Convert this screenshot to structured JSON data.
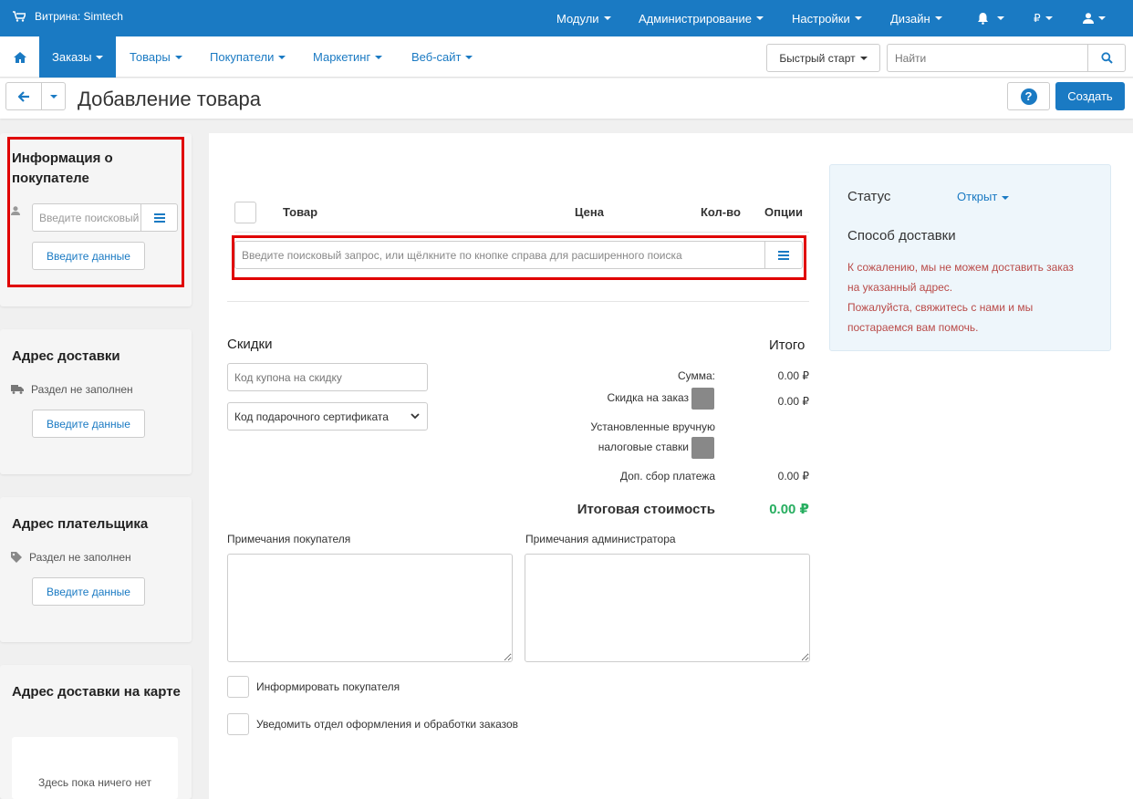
{
  "topbar": {
    "store_label": "Витрина: Simtech",
    "menu": [
      "Модули",
      "Администрирование",
      "Настройки",
      "Дизайн"
    ],
    "currency": "₽"
  },
  "nav": {
    "items": [
      "Заказы",
      "Товары",
      "Покупатели",
      "Маркетинг",
      "Веб-сайт"
    ],
    "quickstart": "Быстрый старт",
    "search_placeholder": "Найти"
  },
  "titlebar": {
    "title": "Добавление товара",
    "help": "?",
    "create": "Создать"
  },
  "sidebar": {
    "customer": {
      "title": "Информация о покупателе",
      "search_placeholder": "Введите поисковый",
      "enter_data": "Введите данные"
    },
    "shipping": {
      "title": "Адрес доставки",
      "empty": "Раздел не заполнен",
      "enter_data": "Введите данные"
    },
    "billing": {
      "title": "Адрес плательщика",
      "empty": "Раздел не заполнен",
      "enter_data": "Введите данные"
    },
    "map": {
      "title": "Адрес доставки на карте",
      "empty": "Здесь пока ничего нет"
    }
  },
  "products": {
    "columns": [
      "Товар",
      "Цена",
      "Кол-во",
      "Опции"
    ],
    "search_placeholder": "Введите поисковый запрос, или щёлкните по кнопке справа для расширенного поиска"
  },
  "discounts": {
    "title": "Скидки",
    "coupon_placeholder": "Код купона на скидку",
    "gift_cert": "Код подарочного сертификата"
  },
  "totals": {
    "title": "Итого",
    "subtotal_label": "Сумма:",
    "subtotal_value": "0.00 ₽",
    "discount_label": "Скидка на заказ",
    "discount_value": "0.00 ₽",
    "tax_label_1": "Установленные вручную",
    "tax_label_2": "налоговые ставки",
    "surcharge_label": "Доп. сбор платежа",
    "surcharge_value": "0.00 ₽",
    "total_label": "Итоговая стоимость",
    "total_value": "0.00 ₽"
  },
  "notes": {
    "customer_label": "Примечания покупателя",
    "admin_label": "Примечания администратора"
  },
  "notify": {
    "customer": "Информировать покупателя",
    "department": "Уведомить отдел оформления и обработки заказов"
  },
  "status": {
    "label": "Статус",
    "value": "Открыт",
    "shipping_title": "Способ доставки",
    "msg_1": "К сожалению, мы не можем доставить заказ",
    "msg_2": "на указанный адрес.",
    "msg_3": "Пожалуйста, свяжитесь с нами и мы",
    "msg_4": "постараемся вам помочь."
  },
  "colors": {
    "accent": "#1a7ac3",
    "total_green": "#27ae60",
    "error_red": "#b94a48",
    "highlight_red": "#e00000"
  },
  "icons": [
    "cart-icon",
    "bell-icon",
    "user-icon",
    "home-icon",
    "search-icon",
    "arrow-left-icon",
    "list-icon",
    "truck-icon",
    "tag-icon"
  ]
}
